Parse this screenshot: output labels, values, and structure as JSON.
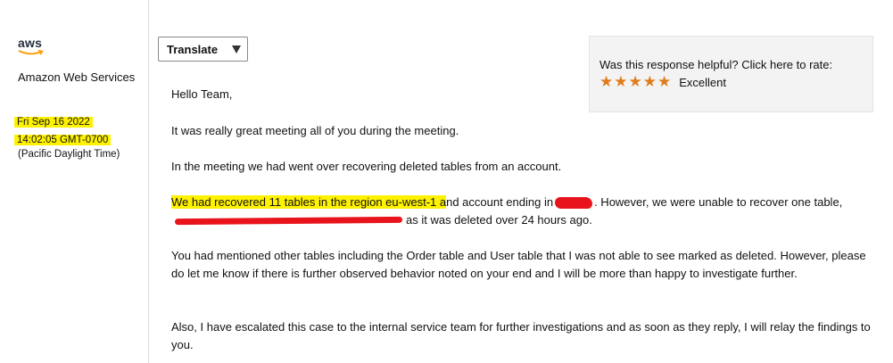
{
  "sender": {
    "logo_text": "aws",
    "name": "Amazon Web Services",
    "date_line1": "Fri Sep 16 2022",
    "date_line2": "14:02:05 GMT-0700",
    "timezone": "(Pacific Daylight Time)"
  },
  "translate": {
    "label": "Translate"
  },
  "rating": {
    "question": "Was this response helpful? Click here to rate:",
    "stars": 5,
    "label": "Excellent",
    "star_color": "#e07b1a"
  },
  "message": {
    "greeting": "Hello Team,",
    "p1": "It was really great meeting all of you during the meeting.",
    "p2": "In the meeting we had went over recovering deleted tables from an account.",
    "p3_highlight": "We had recovered 11 tables in the region eu-west-1 a",
    "p3_a": "nd account ending in",
    "p3_b": ". However, we were unable to recover one table,",
    "p3_c": "as it was deleted over 24 hours ago.",
    "p4": "You had mentioned other tables including the Order table and User table that I was not able to see marked as deleted. However, please do let me know if there is further observed behavior noted on your end and I will be more than happy to investigate further.",
    "p5": "Also, I have escalated this case to the internal service team for further investigations and as soon as they reply, I will relay the findings to you."
  },
  "colors": {
    "highlight": "#fff200",
    "redaction": "#e8131b"
  }
}
